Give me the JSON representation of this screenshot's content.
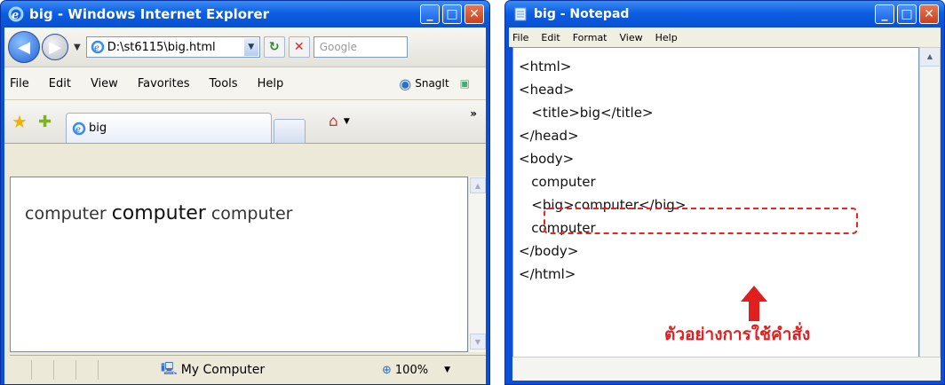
{
  "ie": {
    "title": "big - Windows Internet Explorer",
    "address": "D:\\st6115\\big.html",
    "search_placeholder": "Google",
    "menu": [
      "File",
      "Edit",
      "View",
      "Favorites",
      "Tools",
      "Help"
    ],
    "snagit_label": "SnagIt",
    "tab_label": "big",
    "content": {
      "word1": "computer",
      "word2": "computer",
      "word3": "computer"
    },
    "status": {
      "zone": "My Computer",
      "zoom": "100%"
    },
    "colors": {
      "titlebar": "#0b5ee3",
      "close": "#c9401f"
    }
  },
  "notepad": {
    "title": "big - Notepad",
    "menu": [
      "File",
      "Edit",
      "Format",
      "View",
      "Help"
    ],
    "lines": [
      "<html>",
      "<head>",
      "   <title>big</title>",
      "</head>",
      "<body>",
      "   computer",
      "   <big>computer</big>",
      "   computer",
      "</body>",
      "</html>"
    ],
    "annotation": "ตัวอย่างการใช้คำสั่ง",
    "annotation_color": "#e21f1f"
  }
}
